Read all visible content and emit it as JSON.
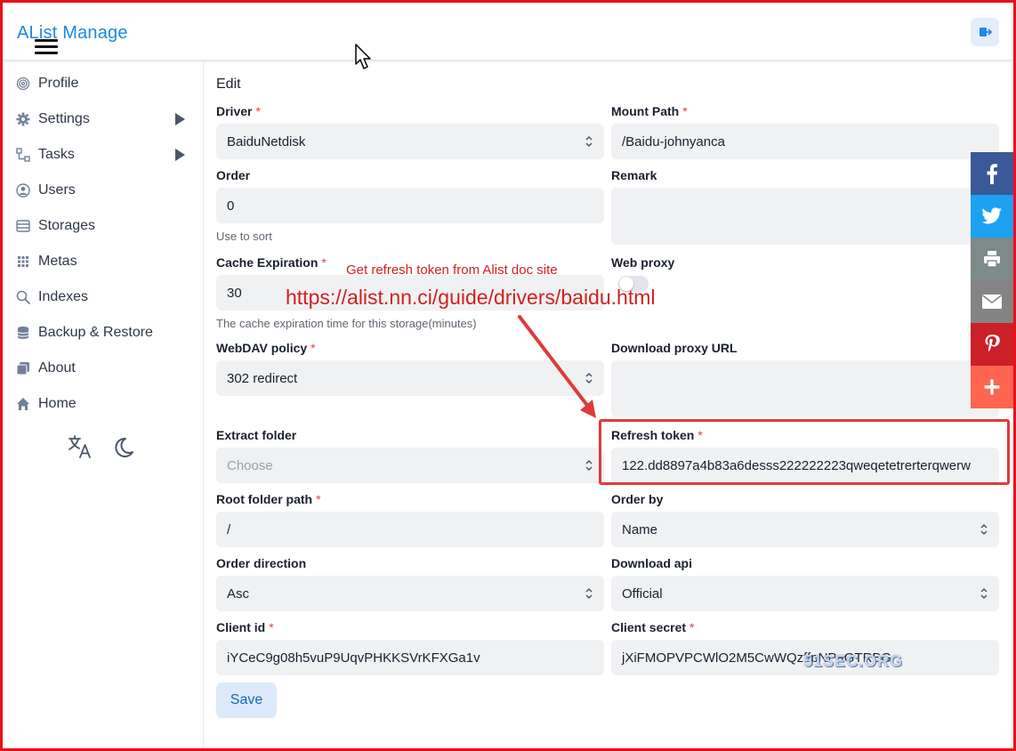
{
  "header": {
    "title": "AList Manage"
  },
  "sidebar": {
    "items": [
      {
        "label": "Profile",
        "icon": "fingerprint-icon"
      },
      {
        "label": "Settings",
        "icon": "gear-icon",
        "expandable": true
      },
      {
        "label": "Tasks",
        "icon": "tasks-icon",
        "expandable": true
      },
      {
        "label": "Users",
        "icon": "user-circle-icon"
      },
      {
        "label": "Storages",
        "icon": "database-icon"
      },
      {
        "label": "Metas",
        "icon": "grid-icon"
      },
      {
        "label": "Indexes",
        "icon": "search-icon"
      },
      {
        "label": "Backup & Restore",
        "icon": "database-stack-icon"
      },
      {
        "label": "About",
        "icon": "copy-icon"
      },
      {
        "label": "Home",
        "icon": "home-icon"
      }
    ]
  },
  "form": {
    "title": "Edit",
    "driver": {
      "label": "Driver",
      "value": "BaiduNetdisk"
    },
    "mount_path": {
      "label": "Mount Path",
      "value": "/Baidu-johnyanca"
    },
    "order": {
      "label": "Order",
      "value": "0",
      "helper": "Use to sort"
    },
    "remark": {
      "label": "Remark",
      "value": ""
    },
    "cache_expiration": {
      "label": "Cache Expiration",
      "value": "30",
      "helper": "The cache expiration time for this storage(minutes)"
    },
    "web_proxy": {
      "label": "Web proxy",
      "enabled": false
    },
    "webdav_policy": {
      "label": "WebDAV policy",
      "value": "302 redirect"
    },
    "download_proxy_url": {
      "label": "Download proxy URL",
      "value": ""
    },
    "extract_folder": {
      "label": "Extract folder",
      "placeholder": "Choose"
    },
    "refresh_token": {
      "label": "Refresh token",
      "value": "122.dd8897a4b83a6desss222222223qweqetetrerterqwerw"
    },
    "root_folder_path": {
      "label": "Root folder path",
      "value": "/"
    },
    "order_by": {
      "label": "Order by",
      "value": "Name"
    },
    "order_direction": {
      "label": "Order direction",
      "value": "Asc"
    },
    "download_api": {
      "label": "Download api",
      "value": "Official"
    },
    "client_id": {
      "label": "Client id",
      "value": "iYCeC9g08h5vuP9UqvPHKKSVrKFXGa1v"
    },
    "client_secret": {
      "label": "Client secret",
      "value": "jXiFMOPVPCWlO2M5CwWQzffpNPaGTRBG"
    },
    "save_label": "Save"
  },
  "annotations": {
    "note": "Get refresh token from Alist doc site",
    "url": "https://alist.nn.ci/guide/drivers/baidu.html"
  },
  "watermark": "51SEC.ORG",
  "share_bar": [
    {
      "name": "facebook",
      "color": "#3b5998"
    },
    {
      "name": "twitter",
      "color": "#1da1f2"
    },
    {
      "name": "print",
      "color": "#7d8a8a"
    },
    {
      "name": "email",
      "color": "#848484"
    },
    {
      "name": "pinterest",
      "color": "#cb2027"
    },
    {
      "name": "more",
      "color": "#ff6550"
    }
  ],
  "colors": {
    "accent": "#1e88e5",
    "required": "#e53e3e",
    "annotation": "#d41f1f",
    "frame": "#e8111c"
  }
}
